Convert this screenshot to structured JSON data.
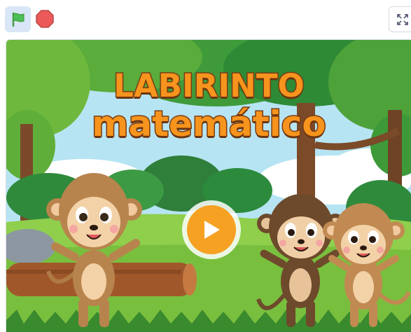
{
  "toolbar": {
    "green_flag_icon": "green-flag-icon",
    "stop_icon": "stop-sign-icon",
    "fullscreen_icon": "fullscreen-icon"
  },
  "stage": {
    "title_line1": "LABIRINTO",
    "title_line2": "matemático",
    "play_icon": "play-icon"
  },
  "colors": {
    "flag_green": "#4cbf56",
    "stop_red": "#ec5959",
    "title_orange": "#f7941d",
    "title_outline": "#7a3c12",
    "play_orange": "#f6a122"
  }
}
